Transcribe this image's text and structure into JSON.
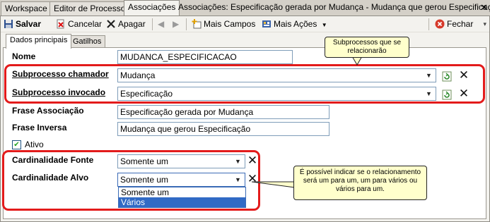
{
  "top_tabs": [
    "Workspace",
    "Editor de Processos",
    "Associações"
  ],
  "window_title": "Associações: Especificação gerada por Mudança - Mudança que gerou Especificação [*]",
  "toolbar": {
    "save": "Salvar",
    "cancel": "Cancelar",
    "delete": "Apagar",
    "more_fields": "Mais Campos",
    "more_actions": "Mais Ações",
    "close": "Fechar"
  },
  "inner_tabs": [
    "Dados principais",
    "Gatilhos"
  ],
  "form": {
    "nome_label": "Nome",
    "nome_value": "MUDANCA_ESPECIFICACAO",
    "sub_chamador_label": "Subprocesso chamador",
    "sub_chamador_value": "Mudança",
    "sub_invocado_label": "Subprocesso invocado",
    "sub_invocado_value": "Especificação",
    "frase_assoc_label": "Frase Associação",
    "frase_assoc_value": "Especificação gerada por Mudança",
    "frase_inversa_label": "Frase Inversa",
    "frase_inversa_value": "Mudança que gerou Especificação",
    "ativo_label": "Ativo",
    "ativo_checked": true,
    "card_fonte_label": "Cardinalidade Fonte",
    "card_fonte_value": "Somente um",
    "card_alvo_label": "Cardinalidade Alvo",
    "card_alvo_value": "Somente um",
    "card_alvo_options": [
      "Somente um",
      "Vários"
    ],
    "card_alvo_highlighted": "Vários"
  },
  "callouts": {
    "subprocessos": "Subprocessos que se relacionarão",
    "cardinalidade": "É possível indicar se o relacionamento será um para um, um para vários ou vários para um."
  },
  "colors": {
    "highlight_red": "#e31b1b",
    "callout_yellow": "#ffffcc",
    "selection_blue": "#316ac5"
  }
}
